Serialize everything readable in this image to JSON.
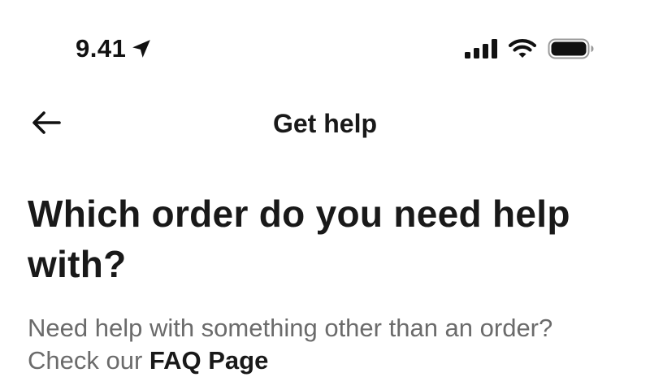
{
  "status_bar": {
    "time": "9.41",
    "icons": [
      "location-arrow-icon",
      "cellular-signal-icon",
      "wifi-icon",
      "battery-icon"
    ]
  },
  "nav": {
    "back_icon": "arrow-left-icon",
    "title": "Get help"
  },
  "main": {
    "heading": "Which order do you need help with?",
    "subtext": "Need help with something other than an order?",
    "faq_prefix": "Check our ",
    "faq_link": "FAQ Page"
  },
  "colors": {
    "text_primary": "#191919",
    "text_secondary": "#6b6b6b",
    "background": "#ffffff"
  }
}
